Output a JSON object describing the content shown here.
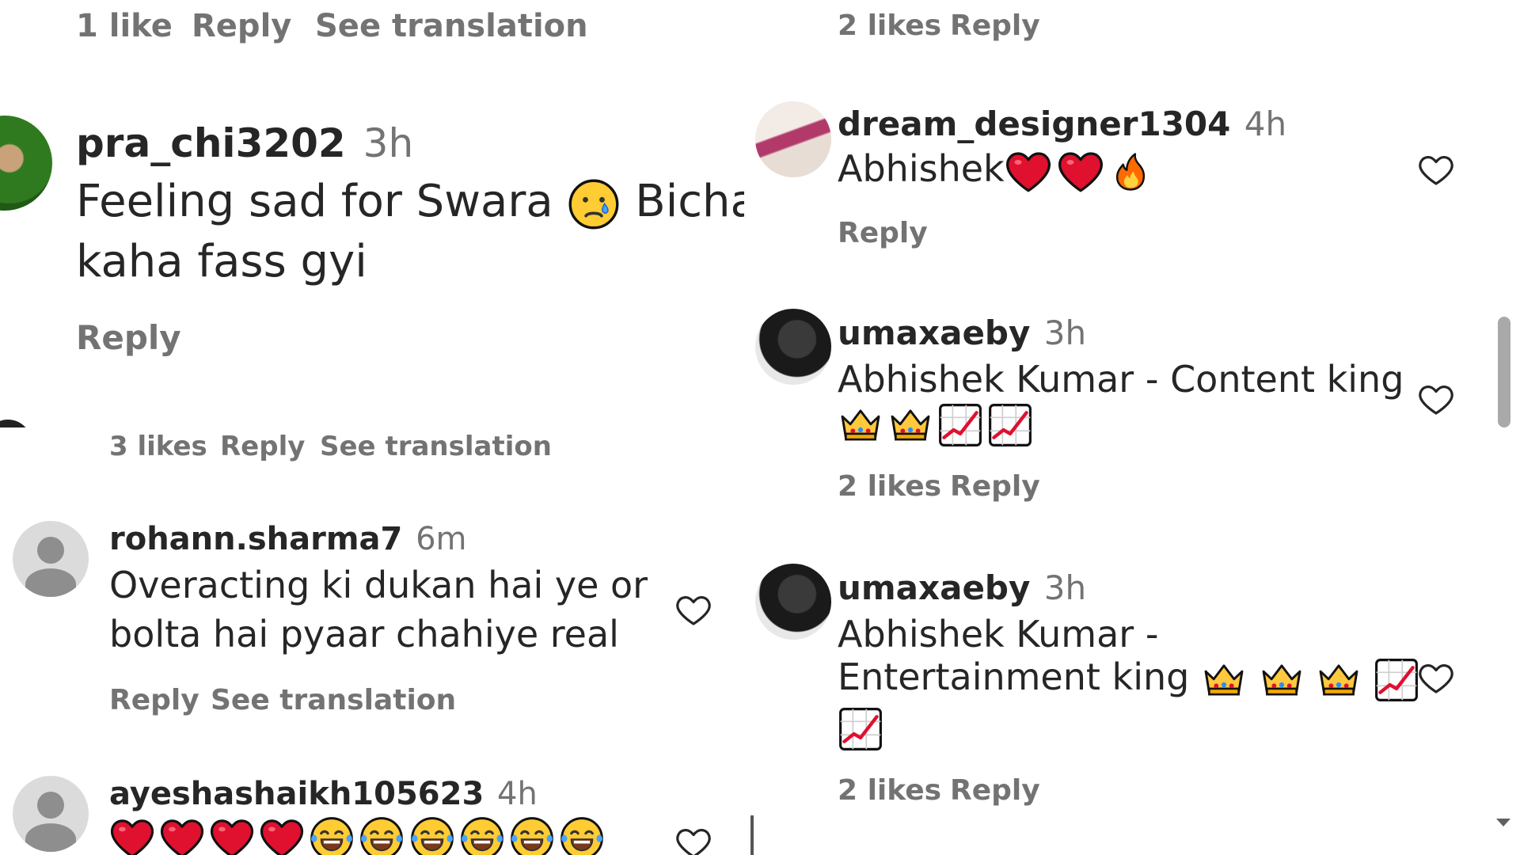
{
  "left_top": {
    "prev_actions": {
      "likes": "1 like",
      "reply": "Reply",
      "translate": "See translation"
    },
    "comment": {
      "username": "pra_chi3202",
      "time": "3h",
      "text_line1": "Feeling sad for Swara",
      "text_line1b": "Bichari",
      "text_line2": "kaha fass gyi",
      "reply": "Reply"
    }
  },
  "left_bottom": {
    "prev_actions": {
      "likes": "3 likes",
      "reply": "Reply",
      "translate": "See translation"
    },
    "comments": [
      {
        "username": "rohann.sharma7",
        "time": "6m",
        "text_line1": "Overacting ki dukan hai ye or",
        "text_line2": "bolta hai pyaar chahiye real",
        "reply": "Reply",
        "translate": "See translation"
      },
      {
        "username": "ayeshashaikh105623",
        "time": "4h"
      }
    ]
  },
  "right": {
    "prev_actions": {
      "likes": "2 likes",
      "reply": "Reply"
    },
    "comments": [
      {
        "username": "dream_designer1304",
        "time": "4h",
        "text": "Abhishek",
        "reply": "Reply"
      },
      {
        "username": "umaxaeby",
        "time": "3h",
        "text_line1": "Abhishek Kumar - Content king",
        "likes": "2 likes",
        "reply": "Reply"
      },
      {
        "username": "umaxaeby",
        "time": "3h",
        "text_line1": "Abhishek Kumar -",
        "text_line2": "Entertainment king",
        "likes": "2 likes",
        "reply": "Reply"
      }
    ]
  },
  "icons": {
    "heart": "heart-icon",
    "crying": "crying-face-emoji",
    "joy": "tears-of-joy-emoji",
    "red_heart": "red-heart-emoji",
    "fire": "fire-emoji",
    "crown": "crown-emoji",
    "chart": "chart-increasing-emoji"
  }
}
